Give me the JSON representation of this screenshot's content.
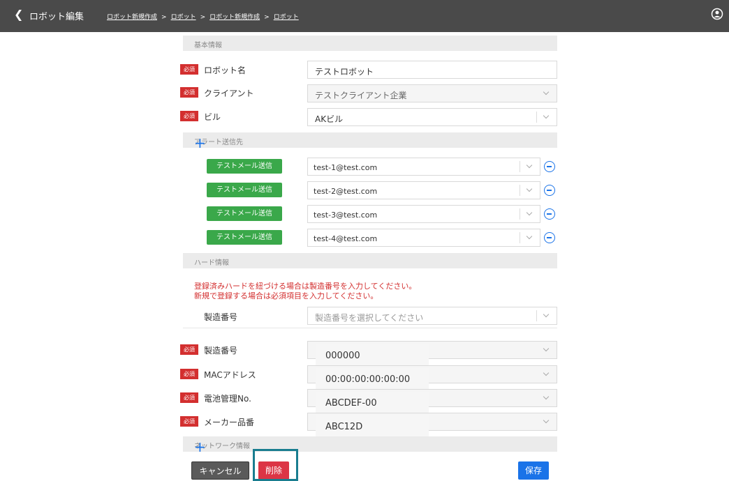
{
  "header": {
    "back_icon": "chevron-left-icon",
    "title": "ロボット編集",
    "breadcrumbs": [
      "ロボット新規作成",
      "ロボット",
      "ロボット新規作成",
      "ロボット"
    ],
    "separator": ">",
    "user_icon": "user-circle-icon"
  },
  "basic": {
    "section_title": "基本情報",
    "required_badge": "必須",
    "robot_name_label": "ロボット名",
    "robot_name_value": "テストロボット",
    "client_label": "クライアント",
    "client_value": "テストクライアント企業",
    "building_label": "ビル",
    "building_value": "AKビル"
  },
  "alert": {
    "section_title": "アラート送信先",
    "test_button": "テストメール送信",
    "emails": [
      "test-1@test.com",
      "test-2@test.com",
      "test-3@test.com",
      "test-4@test.com"
    ]
  },
  "hardware": {
    "section_title": "ハード情報",
    "note_line1": "登録済みハードを紐づける場合は製造番号を入力してください。",
    "note_line2": "新規で登録する場合は必須項目を入力してください。",
    "serial_select_label": "製造番号",
    "serial_select_placeholder": "製造番号を選択してください",
    "serial_label": "製造番号",
    "serial_value": "000000",
    "mac_label": "MACアドレス",
    "mac_value": "00:00:00:00:00:00",
    "battery_label": "電池管理No.",
    "battery_value": "ABCDEF-00",
    "maker_label": "メーカー品番",
    "maker_value": "ABC12D"
  },
  "network": {
    "section_title": "ネットワーク情報"
  },
  "footer": {
    "cancel_label": "キャンセル",
    "delete_label": "削除",
    "save_label": "保存"
  },
  "colors": {
    "topbar": "#4a4a4a",
    "required": "#d32f2f",
    "test_button": "#3aa84a",
    "accent": "#1a73e8",
    "delete": "#dc3545",
    "cancel": "#5a5a5a",
    "highlight": "#197d8f"
  }
}
